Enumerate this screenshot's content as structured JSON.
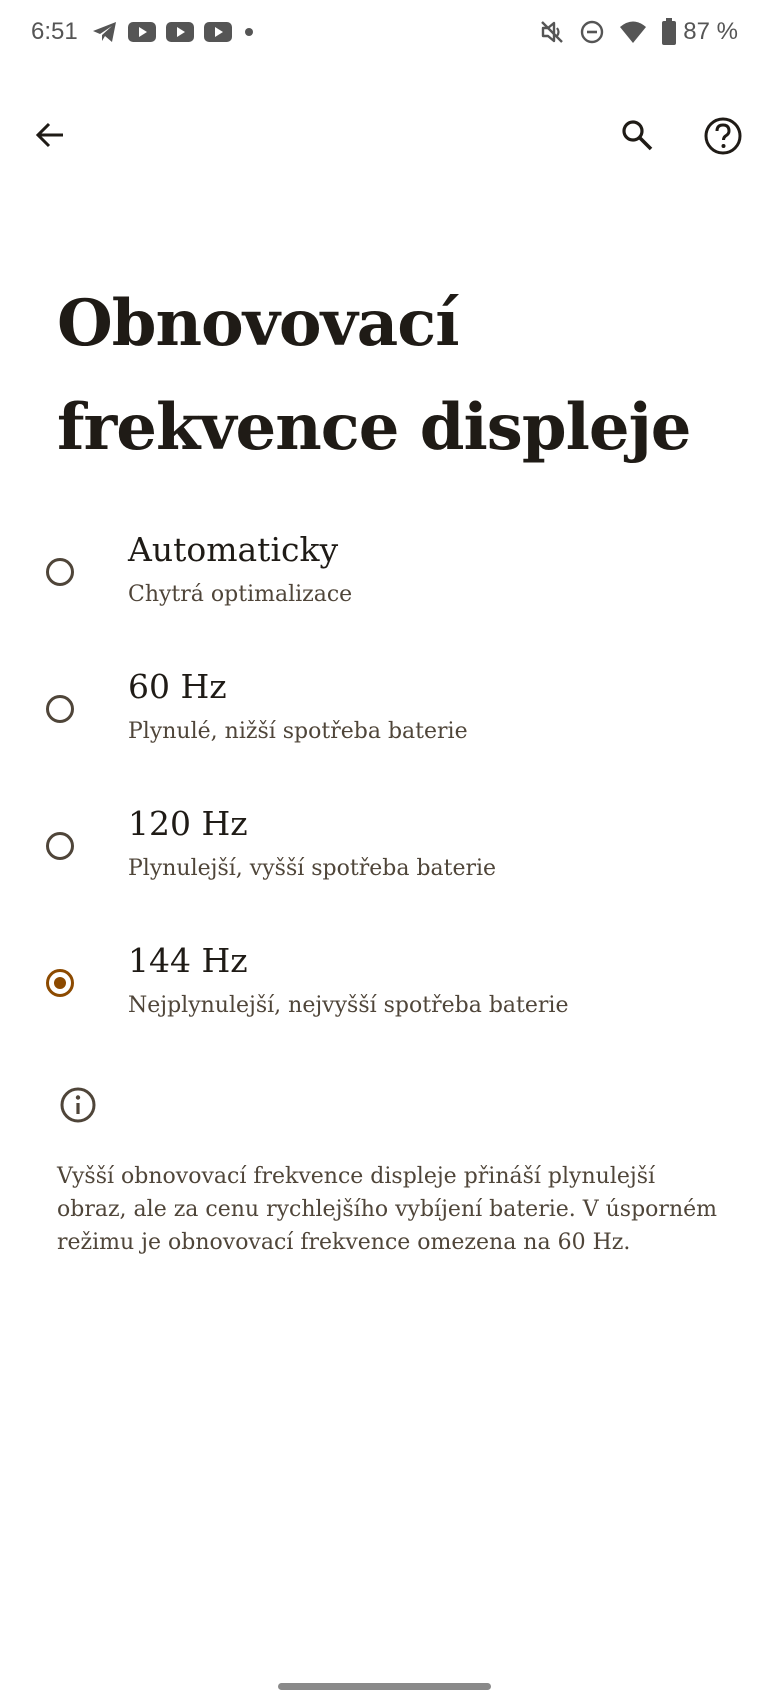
{
  "status_bar": {
    "time": "6:51",
    "battery": "87 %",
    "left_icons": [
      "telegram-icon",
      "youtube-icon",
      "youtube-icon",
      "youtube-icon",
      "dot-icon"
    ],
    "right_icons": [
      "mute-icon",
      "dnd-icon",
      "wifi-icon",
      "battery-icon"
    ]
  },
  "app_bar": {
    "icons": [
      "back-arrow-icon",
      "search-icon",
      "help-icon"
    ]
  },
  "title": "Obnovovací frekvence displeje",
  "options": [
    {
      "title": "Automaticky",
      "subtitle": "Chytrá optimalizace",
      "selected": false
    },
    {
      "title": "60 Hz",
      "subtitle": "Plynulé, nižší spotřeba baterie",
      "selected": false
    },
    {
      "title": "120 Hz",
      "subtitle": "Plynulejší, vyšší spotřeba baterie",
      "selected": false
    },
    {
      "title": "144 Hz",
      "subtitle": "Nejplynulejší, nejvyšší spotřeba baterie",
      "selected": true
    }
  ],
  "info_text": "Vyšší obnovovací frekvence displeje přináší plynulejší obraz, ale za cenu rychlejšího vybíjení baterie. V úsporném režimu je obnovovací frekvence omezena na 60 Hz.",
  "colors": {
    "accent": "#8c4a00",
    "text_primary": "#1f1b16",
    "text_secondary": "#4f4539",
    "background": "#ffffff"
  }
}
